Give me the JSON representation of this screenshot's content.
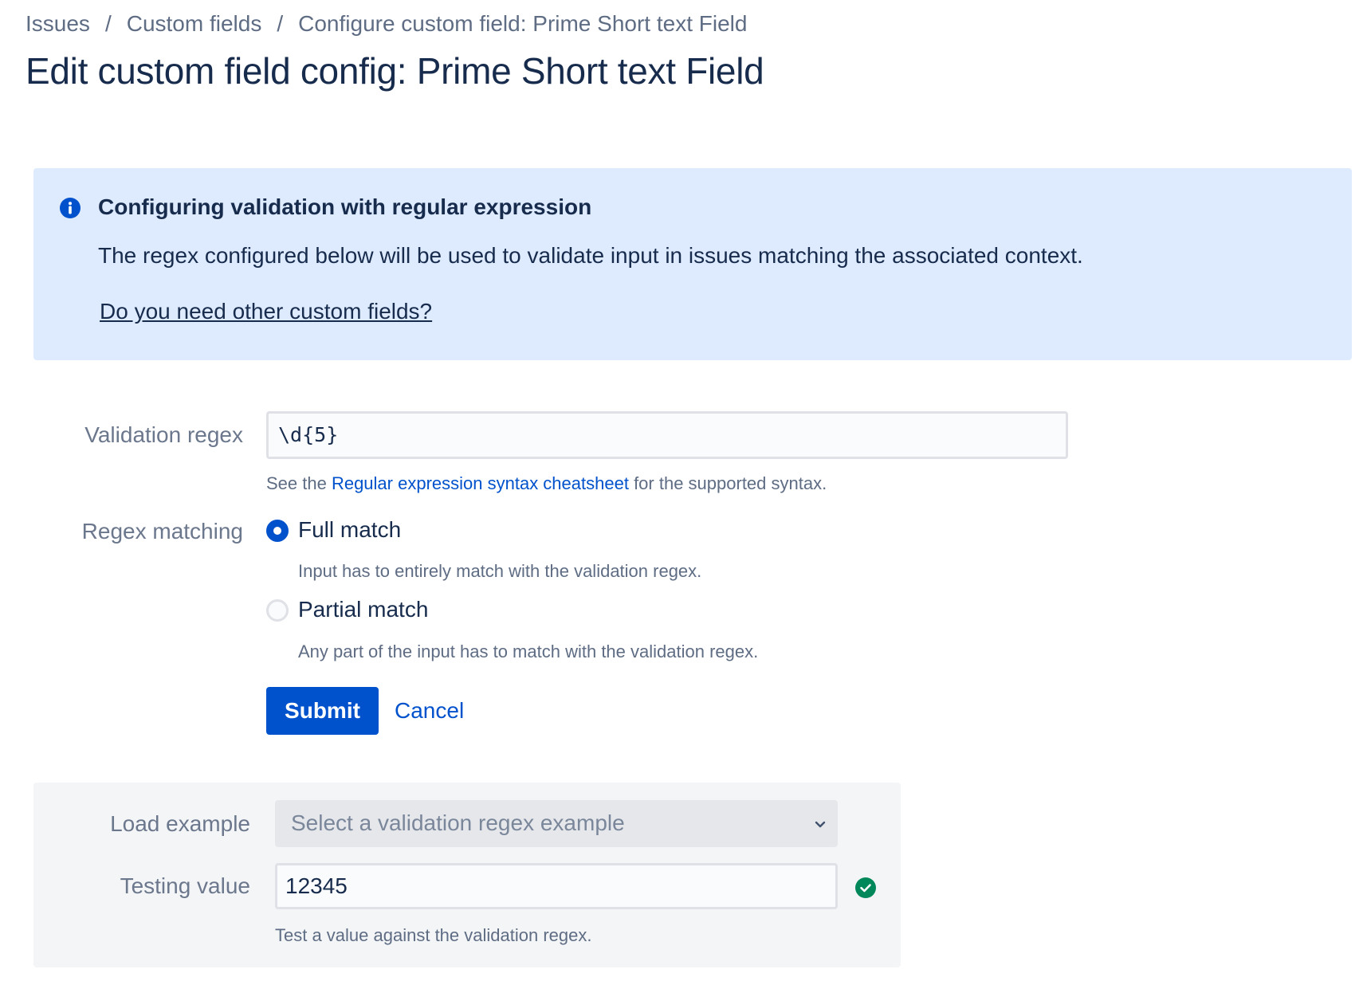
{
  "breadcrumb": {
    "items": [
      "Issues",
      "Custom fields",
      "Configure custom field: Prime Short text Field"
    ],
    "separator": "/"
  },
  "page_title": "Edit custom field config: Prime Short text Field",
  "info_panel": {
    "icon": "info-icon",
    "title": "Configuring validation with regular expression",
    "text": "The regex configured below will be used to validate input in issues matching the associated context.",
    "link": "Do you need other custom fields?"
  },
  "form": {
    "regex_label": "Validation regex",
    "regex_value": "\\d{5}",
    "regex_help_prefix": "See the ",
    "regex_help_link": "Regular expression syntax cheatsheet",
    "regex_help_suffix": " for the supported syntax.",
    "matching_label": "Regex matching",
    "options": [
      {
        "label": "Full match",
        "help": "Input has to entirely match with the validation regex.",
        "selected": true
      },
      {
        "label": "Partial match",
        "help": "Any part of the input has to match with the validation regex.",
        "selected": false
      }
    ],
    "submit_label": "Submit",
    "cancel_label": "Cancel"
  },
  "test_panel": {
    "load_label": "Load example",
    "select_placeholder": "Select a validation regex example",
    "testing_label": "Testing value",
    "testing_value": "12345",
    "testing_help": "Test a value against the validation regex.",
    "status_icon": "check-circle-icon"
  },
  "colors": {
    "primary": "#0052CC",
    "info_background": "#DEEBFF",
    "success": "#00875A",
    "text": "#172B4D",
    "subtle_text": "#6B778C"
  }
}
